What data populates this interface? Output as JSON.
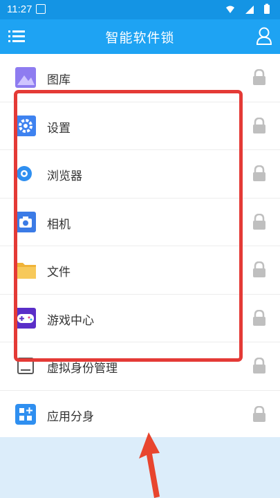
{
  "status_bar": {
    "time": "11:27",
    "icons": [
      "notification-icon",
      "wifi-icon",
      "signal-icon",
      "battery-icon"
    ]
  },
  "app_bar": {
    "title": "智能软件锁",
    "left_icon": "menu-icon",
    "right_icon": "user-icon",
    "color": "#1ea3f3"
  },
  "apps": [
    {
      "label": "图库",
      "icon": "gallery-icon",
      "locked": true
    },
    {
      "label": "设置",
      "icon": "settings-icon",
      "locked": true
    },
    {
      "label": "浏览器",
      "icon": "browser-icon",
      "locked": true
    },
    {
      "label": "相机",
      "icon": "camera-icon",
      "locked": true
    },
    {
      "label": "文件",
      "icon": "folder-icon",
      "locked": true
    },
    {
      "label": "游戏中心",
      "icon": "gamepad-icon",
      "locked": true
    },
    {
      "label": "虚拟身份管理",
      "icon": "virtual-id-icon",
      "locked": true
    },
    {
      "label": "应用分身",
      "icon": "app-clone-icon",
      "locked": true
    }
  ],
  "annotation": {
    "highlight_color": "#e43a36",
    "arrow_color": "#e8452e"
  }
}
